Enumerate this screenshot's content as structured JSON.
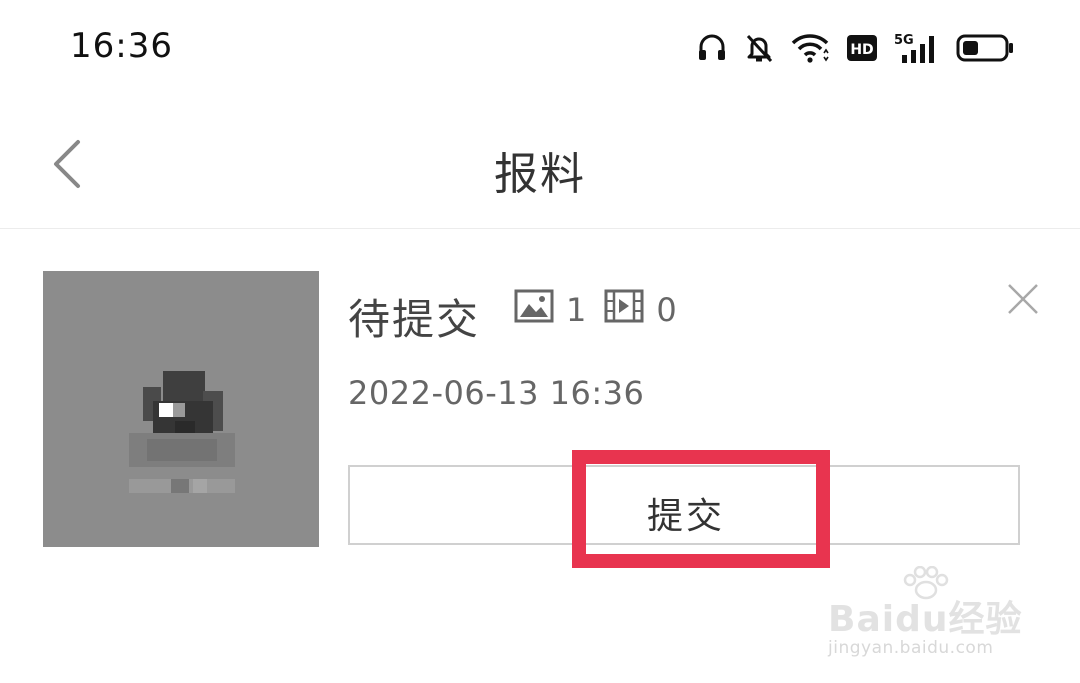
{
  "status_bar": {
    "time": "16:36",
    "network": "5G",
    "hd_badge": "HD",
    "icons": [
      "headset-icon",
      "bell-muted-icon",
      "wifi-icon",
      "hd-icon",
      "signal-icon",
      "battery-icon"
    ]
  },
  "nav": {
    "title": "报料",
    "back_icon": "chevron-left-icon"
  },
  "draft": {
    "status": "待提交",
    "image_count": "1",
    "video_count": "0",
    "datetime": "2022-06-13 16:36",
    "submit_label": "提交",
    "close_icon": "close-icon"
  },
  "annotation": {
    "highlight_color": "#e8344f"
  },
  "watermark": {
    "brand": "Baidu经验",
    "url": "jingyan.baidu.com"
  },
  "colors": {
    "text_primary": "#333333",
    "text_secondary": "#666666",
    "divider": "#ececec",
    "thumb_bg": "#8c8c8c"
  }
}
